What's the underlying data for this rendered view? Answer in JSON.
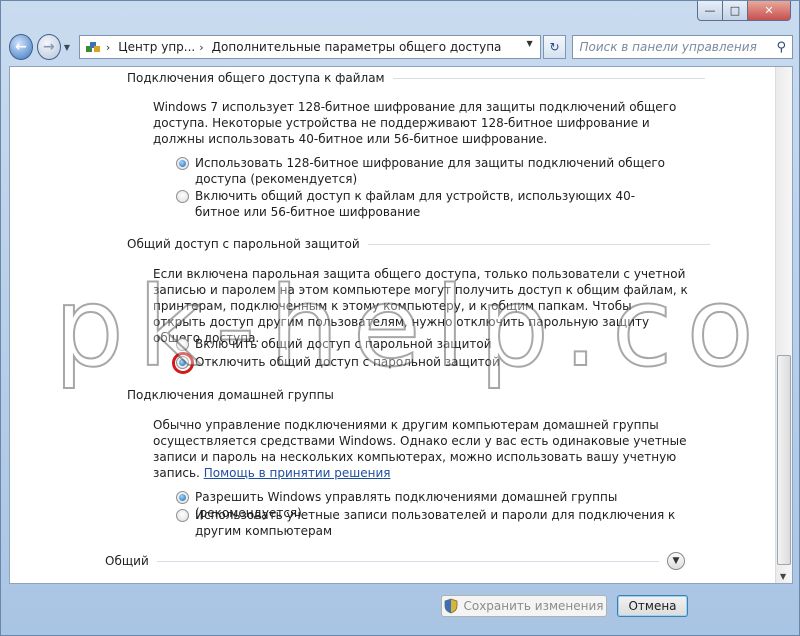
{
  "window": {
    "caption": {
      "minimize": "—",
      "maximize": "□",
      "close": "✕"
    }
  },
  "nav": {
    "back_icon": "←",
    "forward_icon": "→",
    "breadcrumb": [
      "Центр упр...",
      "Дополнительные параметры общего доступа"
    ],
    "crumb_separator": "›",
    "search_placeholder": "Поиск в панели управления"
  },
  "sections": {
    "file_sharing": {
      "heading": "Подключения общего доступа к файлам",
      "description": "Windows 7 использует 128-битное шифрование для защиты подключений общего доступа. Некоторые устройства не поддерживают 128-битное шифрование и должны использовать 40-битное или 56-битное шифрование.",
      "options": [
        {
          "label": "Использовать 128-битное шифрование для защиты подключений общего доступа (рекомендуется)",
          "checked": true
        },
        {
          "label": "Включить общий доступ к файлам для устройств, использующих 40-битное или 56-битное шифрование",
          "checked": false
        }
      ]
    },
    "password": {
      "heading": "Общий доступ с парольной защитой",
      "description": "Если включена парольная защита общего доступа, только пользователи с учетной записью и паролем на этом компьютере могут получить доступ к общим файлам, к принтерам, подключенным к этому компьютеру, и к общим папкам. Чтобы открыть доступ другим пользователям, нужно отключить парольную защиту общего доступа.",
      "options": [
        {
          "label": "Включить общий доступ с парольной защитой",
          "checked": false
        },
        {
          "label": "Отключить общий доступ с парольной защитой",
          "checked": true
        }
      ]
    },
    "homegroup": {
      "heading": "Подключения домашней группы",
      "description": "Обычно управление подключениями к другим компьютерам домашней группы осуществляется средствами Windows. Однако если у вас есть одинаковые учетные записи и пароль на нескольких компьютерах, можно использовать вашу учетную запись.",
      "help_link": "Помощь в принятии решения",
      "options": [
        {
          "label": "Разрешить Windows управлять подключениями домашней группы (рекомендуется)",
          "checked": true
        },
        {
          "label": "Использовать учетные записи пользователей и пароли для подключения к другим компьютерам",
          "checked": false
        }
      ]
    },
    "general": {
      "heading": "Общий"
    }
  },
  "watermark": "pk-help.com",
  "footer": {
    "save_label": "Сохранить изменения",
    "cancel_label": "Отмена"
  },
  "colors": {
    "marker": "#d11a1a",
    "link": "#1f4fa0"
  }
}
